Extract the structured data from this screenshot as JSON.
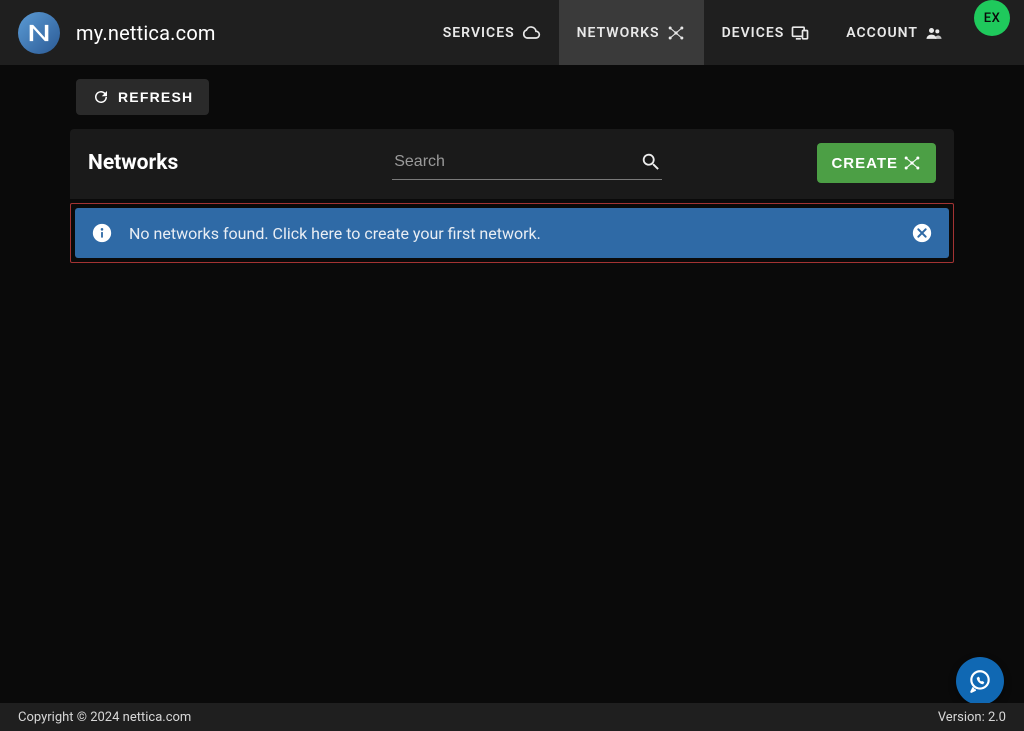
{
  "header": {
    "brand": "my.nettica.com",
    "nav": {
      "services": "SERVICES",
      "networks": "NETWORKS",
      "devices": "DEVICES",
      "account": "ACCOUNT"
    },
    "avatar": "EX"
  },
  "page": {
    "refresh_label": "REFRESH",
    "title": "Networks",
    "search_placeholder": "Search",
    "create_label": "CREATE",
    "alert_message": "No networks found. Click here to create your first network."
  },
  "footer": {
    "copyright": "Copyright © 2024 nettica.com",
    "version": "Version: 2.0"
  }
}
